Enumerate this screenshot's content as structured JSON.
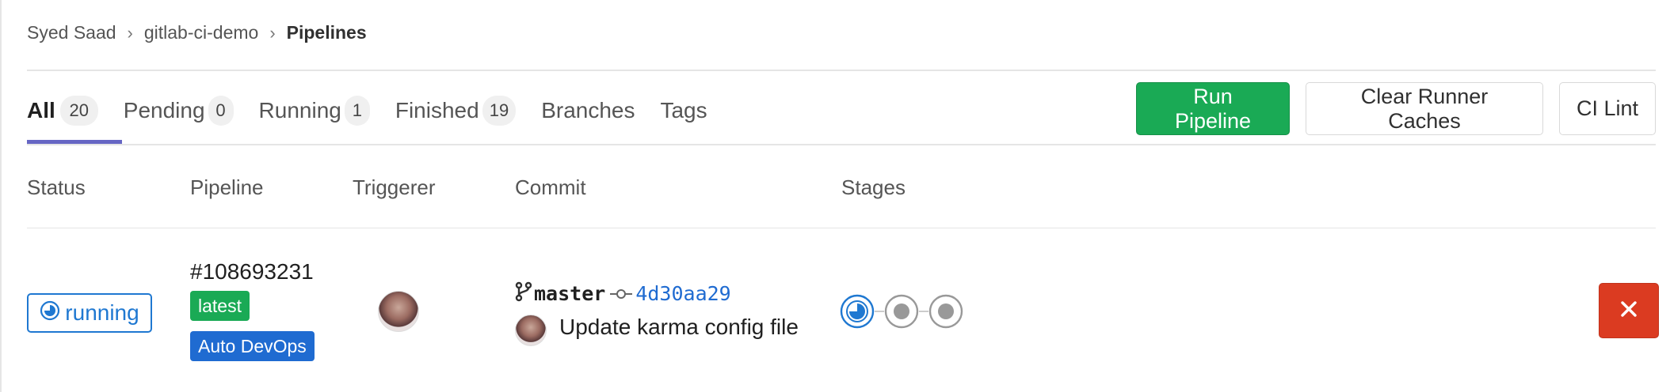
{
  "breadcrumb": {
    "items": [
      "Syed Saad",
      "gitlab-ci-demo",
      "Pipelines"
    ]
  },
  "tabs": [
    {
      "label": "All",
      "count": "20"
    },
    {
      "label": "Pending",
      "count": "0"
    },
    {
      "label": "Running",
      "count": "1"
    },
    {
      "label": "Finished",
      "count": "19"
    },
    {
      "label": "Branches"
    },
    {
      "label": "Tags"
    }
  ],
  "actions": {
    "run_pipeline": "Run Pipeline",
    "clear_caches": "Clear Runner Caches",
    "ci_lint": "CI Lint"
  },
  "table": {
    "headers": [
      "Status",
      "Pipeline",
      "Triggerer",
      "Commit",
      "Stages"
    ]
  },
  "row": {
    "status": "running",
    "pipeline_id": "#108693231",
    "tags": [
      "latest",
      "Auto DevOps"
    ],
    "branch": "master",
    "sha": "4d30aa29",
    "commit_message": "Update karma config file",
    "stages": [
      "running",
      "created",
      "created"
    ]
  },
  "colors": {
    "accent_green": "#1aaa55",
    "running_blue": "#1f78d1",
    "danger_red": "#db3b21",
    "tab_underline": "#6666c4"
  }
}
